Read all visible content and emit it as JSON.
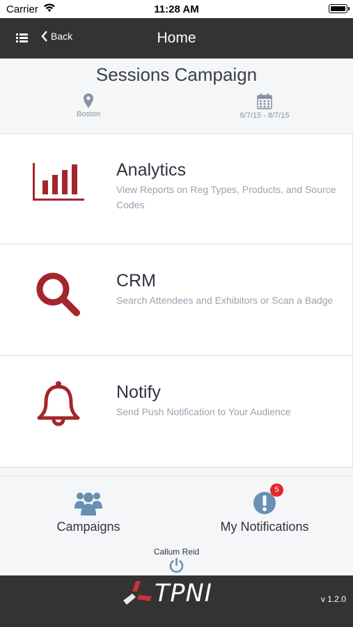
{
  "status_bar": {
    "carrier": "Carrier",
    "time": "11:28 AM"
  },
  "nav": {
    "back_label": "Back",
    "title": "Home"
  },
  "campaign": {
    "title": "Sessions Campaign",
    "location": "Boston",
    "dates": "8/7/15 - 8/7/15"
  },
  "menu": [
    {
      "title": "Analytics",
      "description": "View Reports on Reg Types, Products, and Source Codes",
      "icon": "bar-chart-icon"
    },
    {
      "title": "CRM",
      "description": "Search Attendees and Exhibitors or Scan a Badge",
      "icon": "search-icon"
    },
    {
      "title": "Notify",
      "description": "Send Push Notification to Your Audience",
      "icon": "bell-icon"
    }
  ],
  "tabs": {
    "campaigns_label": "Campaigns",
    "notifications_label": "My Notifications",
    "notifications_badge": "5"
  },
  "user": {
    "name": "Callum Reid"
  },
  "footer": {
    "brand": "TPNI",
    "version": "v 1.2.0"
  },
  "colors": {
    "accent_red": "#a3262d",
    "icon_blue": "#6b8fb3",
    "nav_bg": "#333333",
    "badge_red": "#e8252b"
  }
}
